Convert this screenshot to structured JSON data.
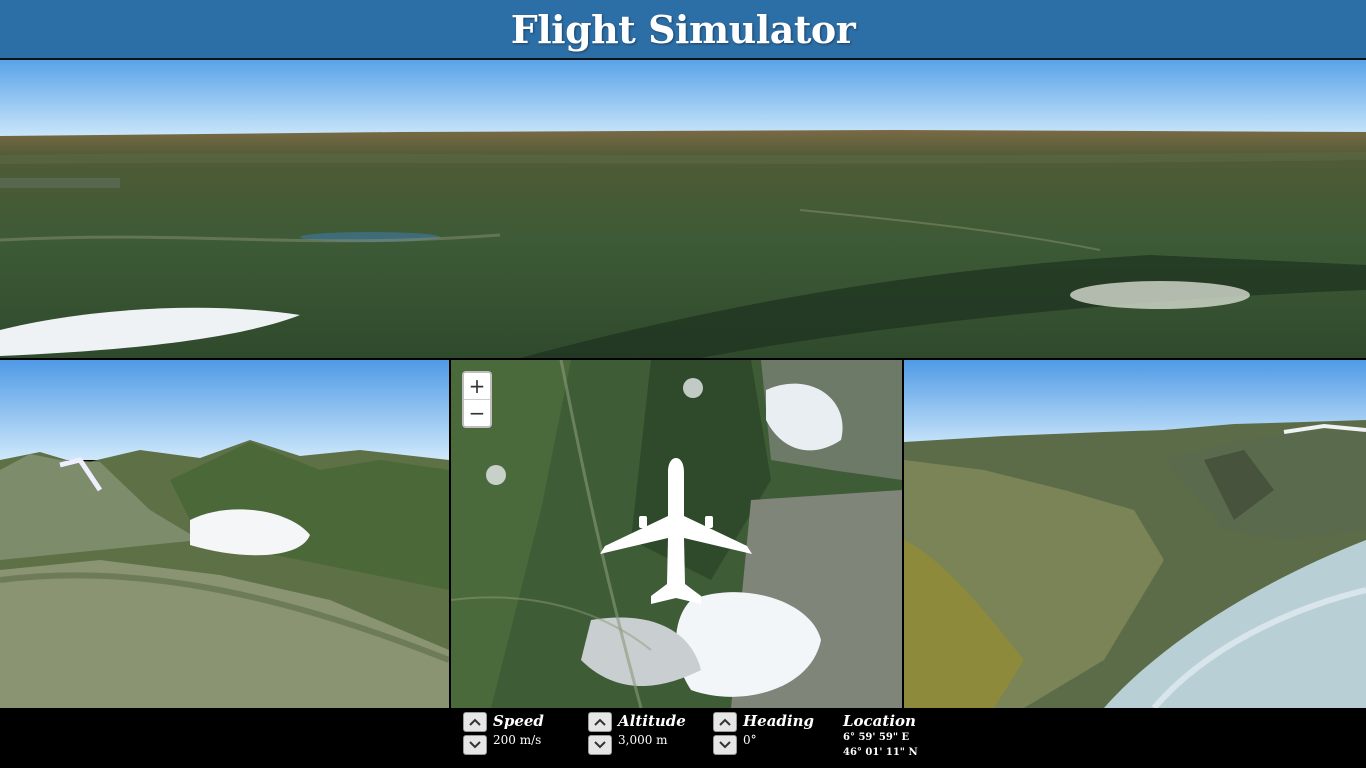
{
  "header": {
    "title": "Flight Simulator"
  },
  "map": {
    "zoom_in_label": "+",
    "zoom_out_label": "−"
  },
  "icons": {
    "plane": "airplane-icon",
    "up": "chevron-up-icon",
    "down": "chevron-down-icon"
  },
  "controls": {
    "speed": {
      "label": "Speed",
      "value": "200 m/s"
    },
    "altitude": {
      "label": "Altitude",
      "value": "3,000 m"
    },
    "heading": {
      "label": "Heading",
      "value": "0°"
    },
    "location": {
      "label": "Location",
      "longitude": "6° 59' 59\" E",
      "latitude": "46° 01' 11\" N"
    }
  },
  "colors": {
    "header": "#2c6ea6",
    "sky_top": "#5aa3e8",
    "sky_bottom": "#c9e6fb",
    "terrain": "#3c5a34",
    "snow": "#f4f6f8"
  }
}
